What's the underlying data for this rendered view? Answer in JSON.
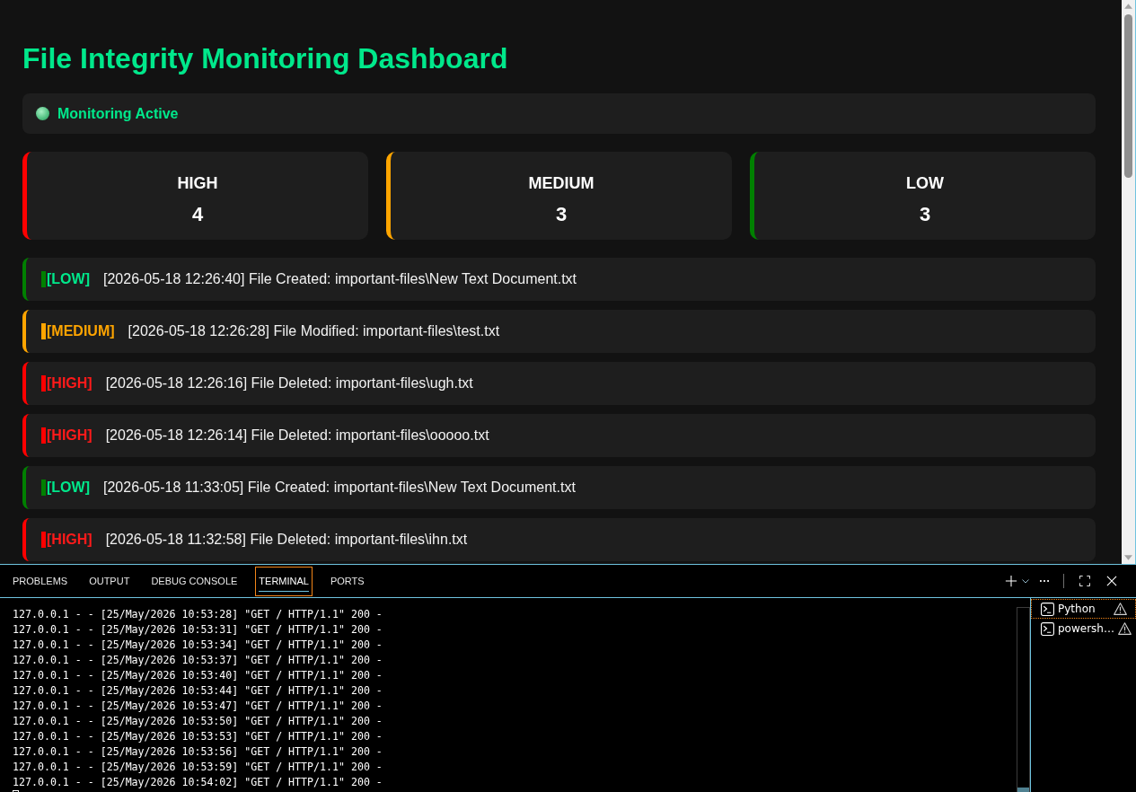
{
  "page": {
    "title": "File Integrity Monitoring Dashboard",
    "status": {
      "label": "Monitoring Active",
      "active": true
    },
    "summary": [
      {
        "kind": "high",
        "label": "HIGH",
        "count": "4"
      },
      {
        "kind": "medium",
        "label": "MEDIUM",
        "count": "3"
      },
      {
        "kind": "low",
        "label": "LOW",
        "count": "3"
      }
    ],
    "events": [
      {
        "kind": "low",
        "label": "[LOW]",
        "message": "[2026-05-18 12:26:40] File Created: important-files\\New Text Document.txt"
      },
      {
        "kind": "medium",
        "label": "[MEDIUM]",
        "message": "[2026-05-18 12:26:28] File Modified: important-files\\test.txt"
      },
      {
        "kind": "high",
        "label": "[HIGH]",
        "message": "[2026-05-18 12:26:16] File Deleted: important-files\\ugh.txt"
      },
      {
        "kind": "high",
        "label": "[HIGH]",
        "message": "[2026-05-18 12:26:14] File Deleted: important-files\\ooooo.txt"
      },
      {
        "kind": "low",
        "label": "[LOW]",
        "message": "[2026-05-18 11:33:05] File Created: important-files\\New Text Document.txt"
      },
      {
        "kind": "high",
        "label": "[HIGH]",
        "message": "[2026-05-18 11:32:58] File Deleted: important-files\\ihn.txt"
      }
    ]
  },
  "panel": {
    "tabs": [
      {
        "label": "PROBLEMS",
        "selected": false
      },
      {
        "label": "OUTPUT",
        "selected": false
      },
      {
        "label": "DEBUG CONSOLE",
        "selected": false
      },
      {
        "label": "TERMINAL",
        "selected": true
      },
      {
        "label": "PORTS",
        "selected": false
      }
    ],
    "terminal_lines": [
      "127.0.0.1 - - [25/May/2026 10:53:28] \"GET / HTTP/1.1\" 200 -",
      "127.0.0.1 - - [25/May/2026 10:53:31] \"GET / HTTP/1.1\" 200 -",
      "127.0.0.1 - - [25/May/2026 10:53:34] \"GET / HTTP/1.1\" 200 -",
      "127.0.0.1 - - [25/May/2026 10:53:37] \"GET / HTTP/1.1\" 200 -",
      "127.0.0.1 - - [25/May/2026 10:53:40] \"GET / HTTP/1.1\" 200 -",
      "127.0.0.1 - - [25/May/2026 10:53:44] \"GET / HTTP/1.1\" 200 -",
      "127.0.0.1 - - [25/May/2026 10:53:47] \"GET / HTTP/1.1\" 200 -",
      "127.0.0.1 - - [25/May/2026 10:53:50] \"GET / HTTP/1.1\" 200 -",
      "127.0.0.1 - - [25/May/2026 10:53:53] \"GET / HTTP/1.1\" 200 -",
      "127.0.0.1 - - [25/May/2026 10:53:56] \"GET / HTTP/1.1\" 200 -",
      "127.0.0.1 - - [25/May/2026 10:53:59] \"GET / HTTP/1.1\" 200 -",
      "127.0.0.1 - - [25/May/2026 10:54:02] \"GET / HTTP/1.1\" 200 -"
    ],
    "terminals": [
      {
        "name": "Python",
        "selected": true
      },
      {
        "name": "powersh…",
        "selected": false
      }
    ]
  }
}
